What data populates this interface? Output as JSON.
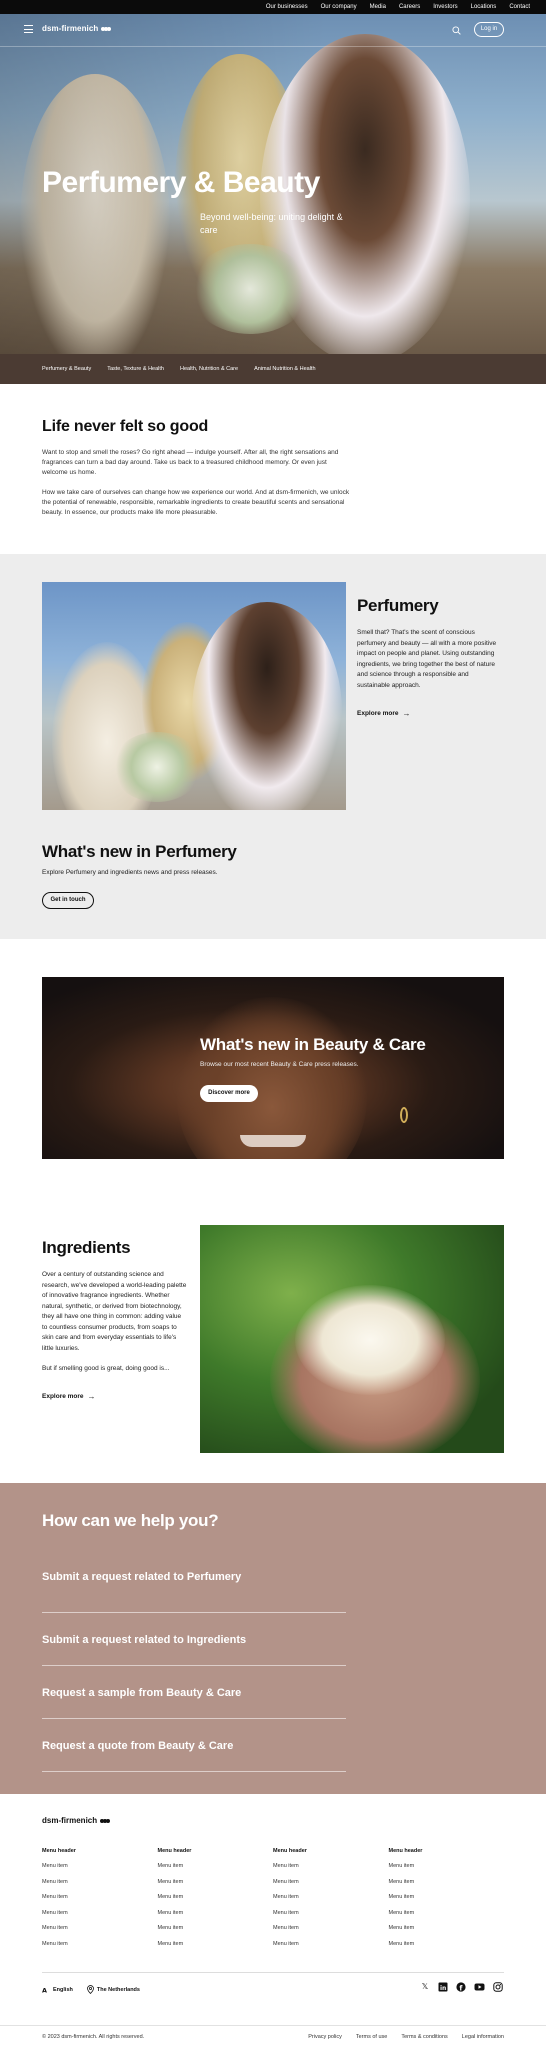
{
  "utility_nav": [
    "Our businesses",
    "Our company",
    "Media",
    "Careers",
    "Investors",
    "Locations",
    "Contact"
  ],
  "header": {
    "logo": "dsm-firmenich",
    "login_label": "Log in"
  },
  "hero": {
    "title": "Perfumery & Beauty",
    "subtitle": "Beyond well-being: uniting delight & care"
  },
  "category_nav": [
    "Perfumery & Beauty",
    "Taste, Texture & Health",
    "Health, Nutrition & Care",
    "Animal Nutrition & Health"
  ],
  "intro": {
    "title": "Life never felt so good",
    "p1": "Want to stop and smell the roses? Go right ahead — indulge yourself. After all, the right sensations and fragrances can turn a bad day around. Take us back to a treasured childhood memory. Or even just welcome us home.",
    "p2": "How we take care of ourselves can change how we experience our world. And at dsm-firmenich, we unlock the potential of renewable, responsible, remarkable ingredients to create beautiful scents and sensational beauty. In essence, our products make life more pleasurable."
  },
  "perfumery": {
    "title": "Perfumery",
    "body": "Smell that? That's the scent of conscious perfumery and beauty — all with a more positive impact on people and planet. Using outstanding ingredients, we bring together the best of nature and science through a responsible and sustainable approach.",
    "explore_label": "Explore more",
    "whats_new_title": "What's new in Perfumery",
    "whats_new_sub": "Explore Perfumery and ingredients news and press releases.",
    "cta_label": "Get in touch"
  },
  "beauty": {
    "title": "What's new in Beauty & Care",
    "sub": "Browse our most recent Beauty & Care press releases.",
    "cta_label": "Discover more"
  },
  "ingredients": {
    "title": "Ingredients",
    "p1": "Over a century of outstanding science and research, we've developed a world-leading palette of innovative fragrance ingredients. Whether natural, synthetic, or derived from biotechnology, they all have one thing in common: adding value to countless consumer products, from soaps to skin care and from everyday essentials to life's little luxuries.",
    "p2": "But if smelling good is great, doing good is...",
    "explore_label": "Explore more"
  },
  "help": {
    "title": "How can we help you?",
    "items": [
      "Submit a request related to Perfumery",
      "Submit a request related to Ingredients",
      "Request a sample from Beauty & Care",
      "Request a quote from Beauty & Care"
    ]
  },
  "footer": {
    "logo": "dsm-firmenich",
    "columns": [
      {
        "header": "Menu header",
        "items": [
          "Menu item",
          "Menu item",
          "Menu item",
          "Menu item",
          "Menu item",
          "Menu item"
        ]
      },
      {
        "header": "Menu header",
        "items": [
          "Menu item",
          "Menu item",
          "Menu item",
          "Menu item",
          "Menu item",
          "Menu item"
        ]
      },
      {
        "header": "Menu header",
        "items": [
          "Menu item",
          "Menu item",
          "Menu item",
          "Menu item",
          "Menu item",
          "Menu item"
        ]
      },
      {
        "header": "Menu header",
        "items": [
          "Menu item",
          "Menu item",
          "Menu item",
          "Menu item",
          "Menu item",
          "Menu item"
        ]
      }
    ],
    "language": "English",
    "country": "The Netherlands",
    "socials": [
      "x-icon",
      "linkedin-icon",
      "facebook-icon",
      "youtube-icon",
      "instagram-icon"
    ],
    "copyright": "© 2023 dsm-firmenich. All rights reserved.",
    "legal": [
      "Privacy policy",
      "Terms of use",
      "Terms & conditions",
      "Legal information"
    ]
  },
  "colors": {
    "category_bar": "#4b3b33",
    "help_bg": "#b39389",
    "section_gray": "#ededed",
    "top_bar": "#0b0b0b"
  }
}
